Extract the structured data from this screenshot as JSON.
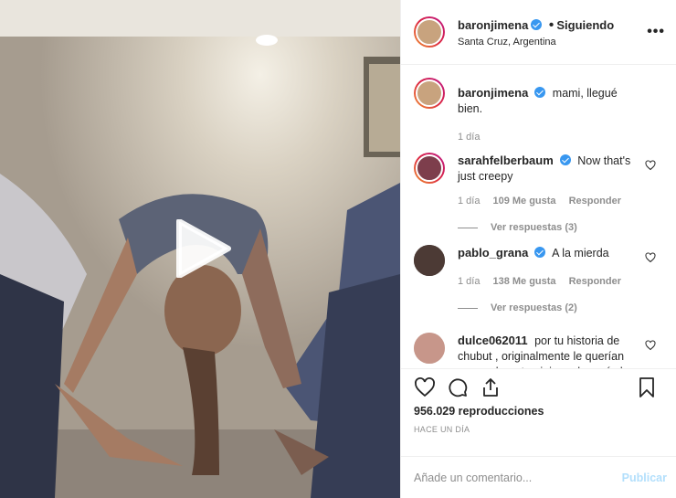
{
  "post": {
    "author": "baronjimena",
    "status_sep": "•",
    "status": "Siguiendo",
    "location": "Santa Cruz, Argentina",
    "more_icon": "more-horizontal-icon",
    "caption": "mami, llegué bien.",
    "caption_time": "1 día"
  },
  "comments": [
    {
      "user": "sarahfelberbaum",
      "verified": true,
      "text": "Now that's just creepy",
      "time": "1 día",
      "likes": "109 Me gusta",
      "reply": "Responder",
      "replies": "Ver respuestas (3)"
    },
    {
      "user": "pablo_grana",
      "verified": true,
      "text": "A la mierda",
      "time": "1 día",
      "likes": "138 Me gusta",
      "reply": "Responder",
      "replies": "Ver respuestas (2)"
    },
    {
      "user": "dulce062011",
      "verified": false,
      "text": "por tu historia de chubut , originalmente le querían poner chupat.... jajaa.. después lo cambiaron"
    }
  ],
  "stats": {
    "views": "956.029 reproducciones",
    "time_ago": "HACE UN DÍA"
  },
  "composer": {
    "placeholder": "Añade un comentario...",
    "publish": "Publicar"
  },
  "colors": {
    "link_blue": "#3897f0",
    "muted": "#8e8e8e",
    "publish_disabled": "#b2dffc"
  }
}
